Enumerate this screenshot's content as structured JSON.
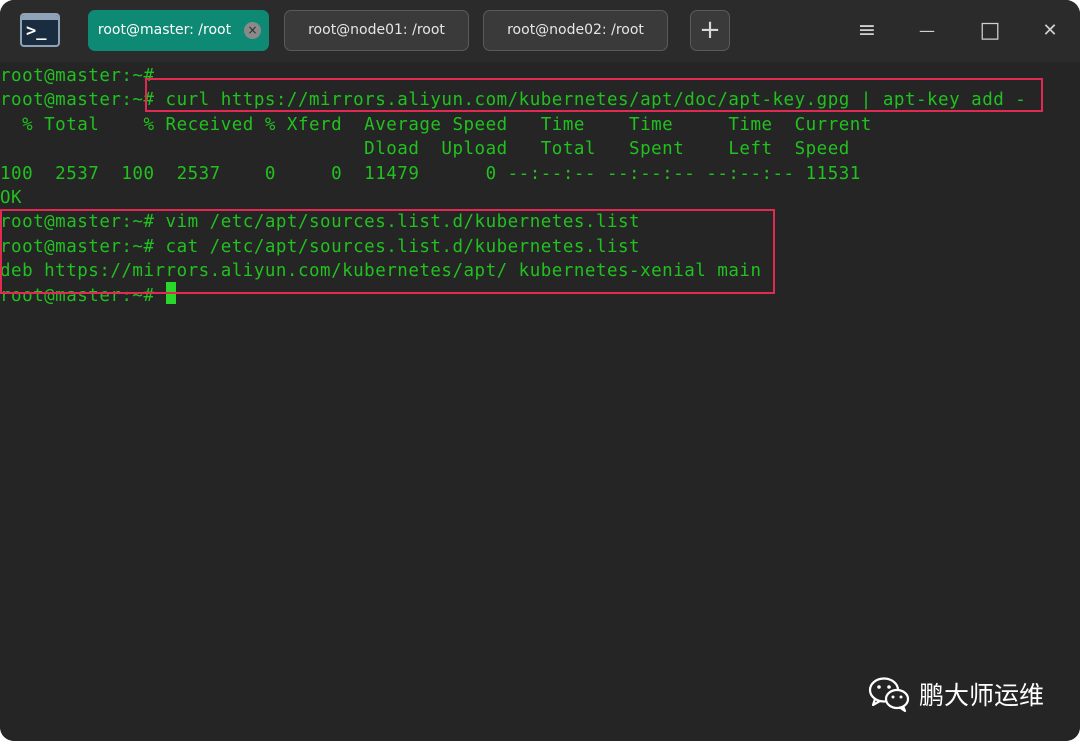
{
  "tabs": [
    {
      "label": "root@master: /root",
      "active": true
    },
    {
      "label": "root@node01: /root",
      "active": false
    },
    {
      "label": "root@node02: /root",
      "active": false
    }
  ],
  "titlebar": {
    "app_icon_glyph": ">_",
    "new_tab_glyph": "+",
    "tab_close_glyph": "×",
    "menu_glyph": "≡",
    "minimize_glyph": "—",
    "maximize_glyph": "□",
    "close_glyph": "✕"
  },
  "terminal": {
    "lines": [
      "root@master:~#",
      "root@master:~# curl https://mirrors.aliyun.com/kubernetes/apt/doc/apt-key.gpg | apt-key add -",
      "  % Total    % Received % Xferd  Average Speed   Time    Time     Time  Current",
      "                                 Dload  Upload   Total   Spent    Left  Speed",
      "100  2537  100  2537    0     0  11479      0 --:--:-- --:--:-- --:--:-- 11531",
      "OK",
      "root@master:~# vim /etc/apt/sources.list.d/kubernetes.list",
      "root@master:~# cat /etc/apt/sources.list.d/kubernetes.list",
      "deb https://mirrors.aliyun.com/kubernetes/apt/ kubernetes-xenial main",
      "root@master:~# "
    ]
  },
  "colors": {
    "terminal_text": "#21c11f",
    "active_tab": "#0e8a74",
    "highlight_box": "#e02a52"
  },
  "watermark": {
    "icon": "wechat-icon",
    "text": "鹏大师运维"
  }
}
